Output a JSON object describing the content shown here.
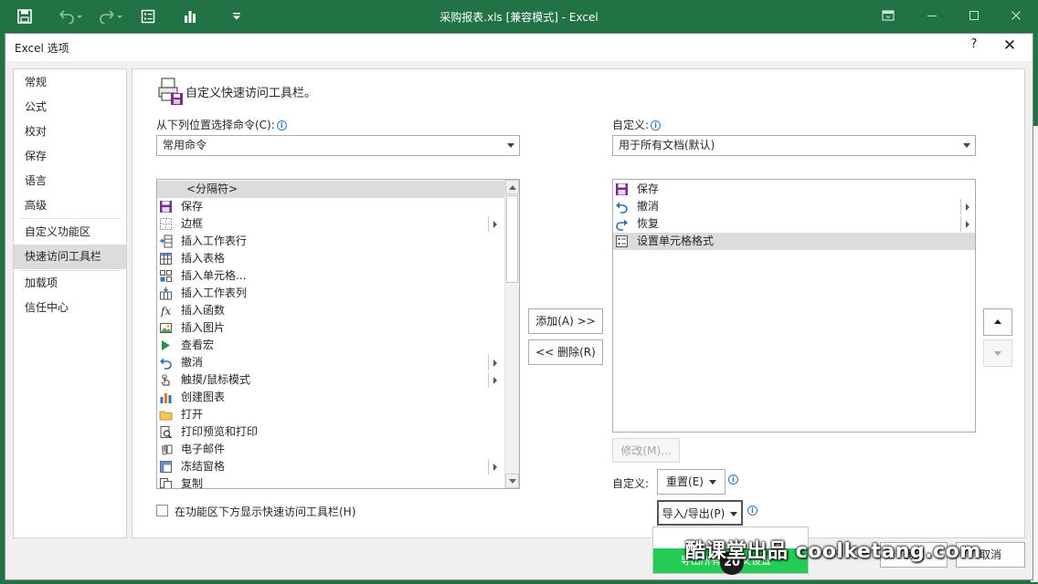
{
  "window": {
    "title": "采购报表.xls  [兼容模式]  -  Excel",
    "accent": "#217346"
  },
  "qat": [
    {
      "icon": "save-icon"
    },
    {
      "icon": "undo-icon"
    },
    {
      "icon": "redo-icon"
    },
    {
      "icon": "format-cells-icon"
    },
    {
      "icon": "bar-chart-icon"
    },
    {
      "icon": "customize-qat-icon"
    }
  ],
  "dialog": {
    "title": "Excel 选项",
    "help": "?",
    "close": "✕"
  },
  "nav": {
    "items": [
      "常规",
      "公式",
      "校对",
      "保存",
      "语言",
      "高级",
      "自定义功能区",
      "快速访问工具栏",
      "加载项",
      "信任中心"
    ],
    "active": "快速访问工具栏"
  },
  "main": {
    "heading": "自定义快速访问工具栏。",
    "choose_label": "从下列位置选择命令(C):",
    "choose_value": "常用命令",
    "customize_label": "自定义:",
    "customize_value": "用于所有文档(默认)",
    "commands": [
      {
        "label": "<分隔符>",
        "icon": "separator-icon",
        "sub": false,
        "selected": true
      },
      {
        "label": "保存",
        "icon": "save-icon",
        "sub": false
      },
      {
        "label": "边框",
        "icon": "border-icon",
        "sub": true
      },
      {
        "label": "插入工作表行",
        "icon": "insert-row-icon",
        "sub": false
      },
      {
        "label": "插入表格",
        "icon": "insert-table-icon",
        "sub": false
      },
      {
        "label": "插入单元格...",
        "icon": "insert-cell-icon",
        "sub": false
      },
      {
        "label": "插入工作表列",
        "icon": "insert-column-icon",
        "sub": false
      },
      {
        "label": "插入函数",
        "icon": "function-icon",
        "sub": false
      },
      {
        "label": "插入图片",
        "icon": "picture-icon",
        "sub": false
      },
      {
        "label": "查看宏",
        "icon": "macro-icon",
        "sub": false
      },
      {
        "label": "撤消",
        "icon": "undo-icon",
        "sub": true
      },
      {
        "label": "触摸/鼠标模式",
        "icon": "touch-icon",
        "sub": true
      },
      {
        "label": "创建图表",
        "icon": "chart-icon",
        "sub": false
      },
      {
        "label": "打开",
        "icon": "folder-icon",
        "sub": false
      },
      {
        "label": "打印预览和打印",
        "icon": "print-preview-icon",
        "sub": false
      },
      {
        "label": "电子邮件",
        "icon": "email-icon",
        "sub": false
      },
      {
        "label": "冻结窗格",
        "icon": "freeze-icon",
        "sub": true
      },
      {
        "label": "复制",
        "icon": "copy-icon",
        "sub": false
      }
    ],
    "toolbar_items": [
      {
        "label": "保存",
        "icon": "save-icon",
        "sub": false
      },
      {
        "label": "撤消",
        "icon": "undo-icon",
        "sub": true
      },
      {
        "label": "恢复",
        "icon": "redo-icon",
        "sub": true
      },
      {
        "label": "设置单元格格式",
        "icon": "format-cells-icon",
        "sub": false,
        "selected": true
      }
    ],
    "add_button": "添加(A) >>",
    "remove_button": "<< 删除(R)",
    "modify_button": "修改(M)...",
    "reset_button": "重置(E)",
    "import_export_button": "导入/导出(P)",
    "show_below_ribbon": "在功能区下方显示快速访问工具栏(H)",
    "ok_button": "确定",
    "cancel_button": "取消"
  },
  "popup": {
    "highlighted": "导出所有自定义设置"
  },
  "overlay": {
    "step_badge": "20",
    "watermark": "酷课堂出品 coolketang.com"
  }
}
